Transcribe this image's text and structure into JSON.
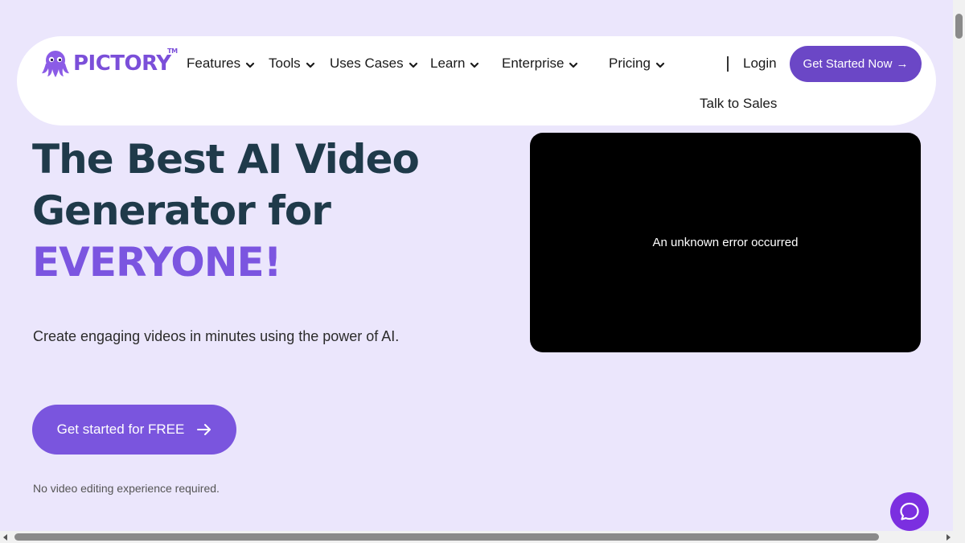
{
  "nav": {
    "brand": "PICTORY",
    "trademark": "TM",
    "items": [
      {
        "label": "Features"
      },
      {
        "label": "Tools"
      },
      {
        "label": "Uses Cases"
      },
      {
        "label": "Learn"
      },
      {
        "label": "Enterprise"
      },
      {
        "label": "Pricing"
      }
    ],
    "login": "Login",
    "cta": "Get Started Now",
    "cta_arrow": "→",
    "talk_to_sales": "Talk to Sales"
  },
  "hero": {
    "title_line1": "The Best AI Video",
    "title_line2": "Generator for",
    "title_accent": "EVERYONE!",
    "subtitle": "Create engaging videos in minutes using the power of AI.",
    "cta": "Get started for FREE",
    "note": "No video editing experience required."
  },
  "video": {
    "error_message": "An unknown error occurred"
  },
  "icons": {
    "logo": "octopus-logo-icon",
    "chevron": "chevron-down-icon",
    "arrow": "arrow-right-icon",
    "chat": "chat-bubble-icon"
  },
  "colors": {
    "background": "#ebe6fc",
    "brand": "#7b4fd9",
    "cta_top": "#6b47c6",
    "cta_hero": "#7a55de",
    "heading": "#1f3a4a",
    "chat": "#7b2fe0"
  }
}
